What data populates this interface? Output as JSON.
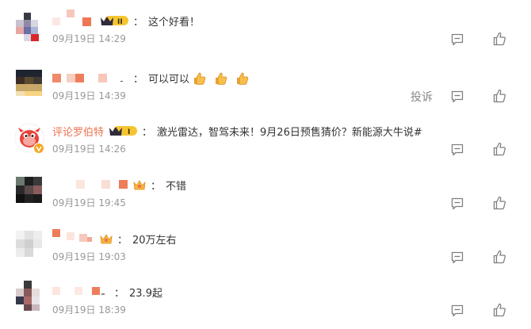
{
  "comments": [
    {
      "username": "",
      "text": "这个好看！",
      "time": "09月19日 14:29",
      "badge": "II"
    },
    {
      "username": "",
      "text": "可以可以",
      "time": "09月19日 14:39",
      "report": "投诉"
    },
    {
      "username": "评论罗伯特",
      "text": "激光雷达，智驾未来！9月26日预售猜价？新能源大牛说#",
      "time": "09月19日 14:26",
      "badge": "I"
    },
    {
      "username": "",
      "text": "不错",
      "time": "09月19日 19:45"
    },
    {
      "username": "",
      "text": "20万左右",
      "time": "09月19日 19:03"
    },
    {
      "username": "",
      "text": "23.9起",
      "time": "09月19日 18:39"
    }
  ],
  "colon": "：",
  "icons": {
    "reply": "comment-icon",
    "like": "thumbs-up-icon",
    "emoji": "thumbs-up-emoji"
  },
  "colors": {
    "username": "#eb7350",
    "time": "#999999",
    "icon": "#7f7f7f",
    "crown": "#f0b429"
  }
}
